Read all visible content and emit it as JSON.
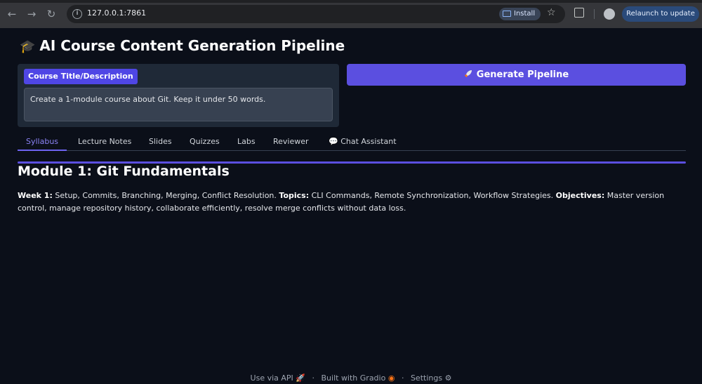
{
  "browser": {
    "url": "127.0.0.1:7861",
    "install_label": "Install",
    "relaunch_label": "Relaunch to update"
  },
  "app": {
    "title": "AI Course Content Generation Pipeline"
  },
  "input": {
    "label": "Course Title/Description",
    "value": "Create a 1-module course about Git. Keep it under 50 words."
  },
  "generate_button": {
    "label": "Generate Pipeline"
  },
  "tabs": [
    {
      "label": "Syllabus",
      "active": true
    },
    {
      "label": "Lecture Notes"
    },
    {
      "label": "Slides"
    },
    {
      "label": "Quizzes"
    },
    {
      "label": "Labs"
    },
    {
      "label": "Reviewer"
    },
    {
      "label": "Chat Assistant"
    }
  ],
  "syllabus": {
    "heading": "Module 1: Git Fundamentals",
    "week_label": "Week 1:",
    "week_text": "Setup, Commits, Branching, Merging, Conflict Resolution.",
    "topics_label": "Topics:",
    "topics_text": "CLI Commands, Remote Synchronization, Workflow Strategies.",
    "objectives_label": "Objectives:",
    "objectives_text": "Master version control, manage repository history, collaborate efficiently, resolve merge conflicts without data loss."
  },
  "footer": {
    "api": "Use via API",
    "built": "Built with Gradio",
    "settings": "Settings"
  },
  "colors": {
    "accent": "#5b4fe0",
    "background": "#0b0f19"
  }
}
